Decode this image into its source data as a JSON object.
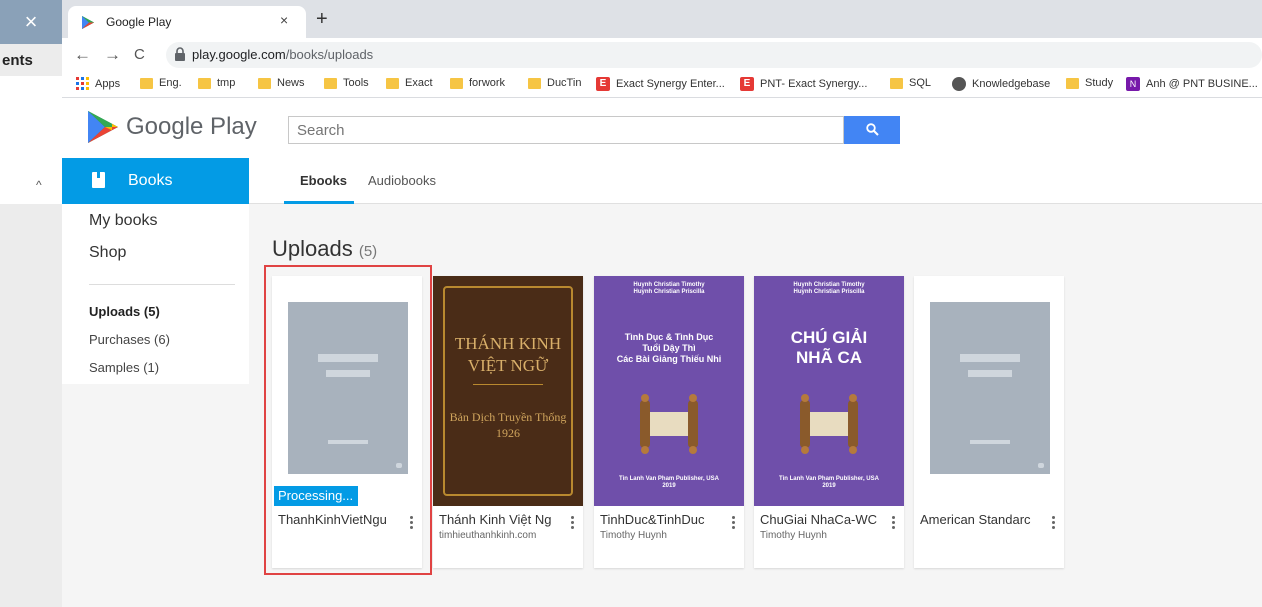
{
  "side_window": {
    "close_glyph": "×",
    "label": "ents",
    "caret": "^"
  },
  "browser": {
    "tab_title": "Google Play",
    "tab_close": "×",
    "new_tab": "+",
    "nav": {
      "back": "←",
      "forward": "→",
      "reload": "C"
    },
    "url_host": "play.google.com",
    "url_path": "/books/uploads"
  },
  "bookmarks": [
    {
      "label": "Apps",
      "icon": "apps-grid-icon"
    },
    {
      "label": "Eng.",
      "icon": "folder-icon"
    },
    {
      "label": "tmp",
      "icon": "folder-icon"
    },
    {
      "label": "News",
      "icon": "folder-icon"
    },
    {
      "label": "Tools",
      "icon": "folder-icon"
    },
    {
      "label": "Exact",
      "icon": "folder-icon"
    },
    {
      "label": "forwork",
      "icon": "folder-icon"
    },
    {
      "label": "DucTin",
      "icon": "folder-icon"
    },
    {
      "label": "Exact Synergy Enter...",
      "icon": "exact-icon"
    },
    {
      "label": "PNT- Exact Synergy...",
      "icon": "exact-icon"
    },
    {
      "label": "SQL",
      "icon": "folder-icon"
    },
    {
      "label": "Knowledgebase",
      "icon": "globe-icon"
    },
    {
      "label": "Study",
      "icon": "folder-icon"
    },
    {
      "label": "Anh @ PNT BUSINE...",
      "icon": "onenote-icon"
    }
  ],
  "header": {
    "logo_text": "Google Play",
    "search_placeholder": "Search",
    "search_button_glyph": "⚲"
  },
  "category": {
    "label": "Books"
  },
  "tabs": [
    {
      "label": "Ebooks",
      "active": true
    },
    {
      "label": "Audiobooks",
      "active": false
    }
  ],
  "leftnav": {
    "items": [
      "My books",
      "Shop"
    ],
    "sub_items": [
      "Uploads (5)",
      "Purchases (6)",
      "Samples (1)"
    ]
  },
  "uploads": {
    "title": "Uploads",
    "count": "(5)"
  },
  "books": [
    {
      "title": "ThanhKinhVietNgu",
      "subtitle": "",
      "status": "Processing...",
      "cover": "placeholder"
    },
    {
      "title": "Thánh Kinh Việt Ng",
      "subtitle": "timhieuthanhkinh.com",
      "cover": "brown",
      "cover_text": [
        "THÁNH KINH",
        "VIỆT NGỮ",
        "Bản Dịch Truyền Thống",
        "1926"
      ]
    },
    {
      "title": "TinhDuc&TinhDuc",
      "subtitle": "Timothy Huynh",
      "cover": "purple",
      "cover_author": [
        "Huynh Christian Timothy",
        "Huỳnh Christian Priscilla"
      ],
      "cover_title": [
        "Tình Dục & Tình Dục",
        "Tuổi Dậy Thì",
        "Các Bài Giảng Thiếu Nhi"
      ],
      "cover_pub": [
        "Tin Lanh Van Pham Publisher, USA",
        "2019"
      ]
    },
    {
      "title": "ChuGiai NhaCa-WC",
      "subtitle": "Timothy Huynh",
      "cover": "purple",
      "cover_author": [
        "Huynh Christian Timothy",
        "Huỳnh Christian Priscilla"
      ],
      "cover_title": [
        "CHÚ GIẢI",
        "NHÃ CA"
      ],
      "cover_pub": [
        "Tin Lanh Van Pham Publisher, USA",
        "2019"
      ]
    },
    {
      "title": "American Standarc",
      "subtitle": "",
      "cover": "placeholder"
    }
  ],
  "colors": {
    "accent": "#039be5",
    "highlight": "#e04343",
    "purple_cover": "#6f4faa",
    "search_button": "#4285f4"
  }
}
